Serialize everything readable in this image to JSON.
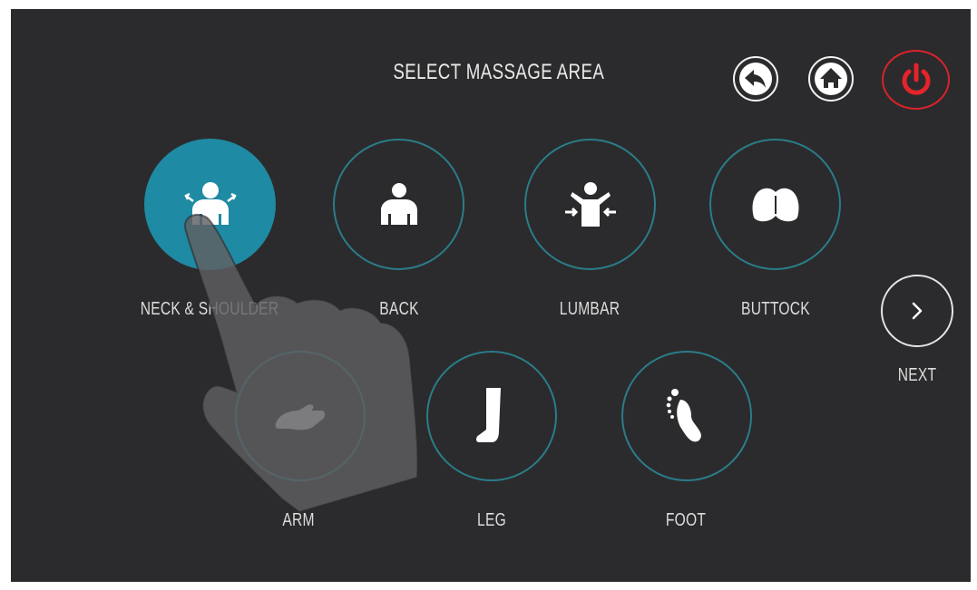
{
  "screen": {
    "title": "SELECT MASSAGE AREA"
  },
  "controls": {
    "back_icon": "back-arrow-icon",
    "home_icon": "home-icon",
    "power_icon": "power-icon",
    "power_color": "#d8232a"
  },
  "areas": [
    {
      "label": "NECK & SHOULDER",
      "icon": "neck-shoulder-icon",
      "selected": true
    },
    {
      "label": "BACK",
      "icon": "back-body-icon",
      "selected": false
    },
    {
      "label": "LUMBAR",
      "icon": "lumbar-icon",
      "selected": false
    },
    {
      "label": "BUTTOCK",
      "icon": "buttock-icon",
      "selected": false
    },
    {
      "label": "ARM",
      "icon": "arm-icon",
      "selected": false
    },
    {
      "label": "LEG",
      "icon": "leg-icon",
      "selected": false
    },
    {
      "label": "FOOT",
      "icon": "foot-icon",
      "selected": false
    }
  ],
  "next": {
    "label": "NEXT",
    "icon": "chevron-right-icon"
  },
  "colors": {
    "background": "#2b2b2d",
    "accent": "#1f8aa3",
    "ring": "#2a7d89",
    "text": "#dcdcdc"
  }
}
